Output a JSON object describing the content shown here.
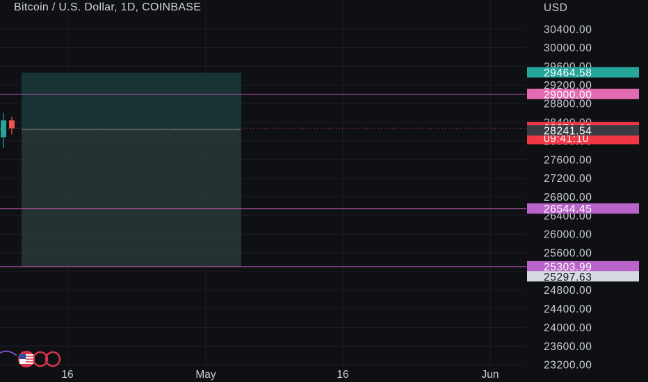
{
  "header": {
    "title": "Bitcoin / U.S. Dollar, 1D, COINBASE",
    "currency": "USD"
  },
  "colors": {
    "background": "#0f1014",
    "grid": "#1c1e24",
    "profit_zone": "#1a3a38",
    "loss_zone": "#2b3a3a",
    "horizontal_line": "#c25ab7",
    "up_candle": "#26a69a",
    "down_candle": "#ef5350",
    "tag_green": "#26a69a",
    "tag_pink": "#e26bb2",
    "tag_red": "#f23645",
    "tag_purple": "#b964c9",
    "tag_dark": "#3a3c43",
    "tag_light": "#d6dbe1"
  },
  "chart_data": {
    "type": "candlestick",
    "title": "Bitcoin / U.S. Dollar, 1D, COINBASE",
    "ylabel": "USD",
    "ylim": [
      23050,
      30720
    ],
    "yticks": [
      23200,
      23600,
      24000,
      24400,
      24800,
      25200,
      25600,
      26000,
      26400,
      26800,
      27200,
      27600,
      28000,
      28400,
      28800,
      29200,
      29600,
      30000,
      30400
    ],
    "xticks": [
      "16",
      "May",
      "16",
      "Jun"
    ],
    "grid": true,
    "candles": [
      {
        "open": 28080,
        "high": 28600,
        "low": 27850,
        "close": 28440
      },
      {
        "open": 28440,
        "high": 28520,
        "low": 28140,
        "close": 28271
      }
    ],
    "position": {
      "target": 29464.58,
      "entry": 28241.54,
      "stop": 25297.63
    },
    "horizontal_lines": [
      29000.0,
      26544.45,
      25303.99
    ],
    "price_tags": [
      {
        "label": "29464.58",
        "value": 29464.58,
        "role": "target",
        "color": "tag_green"
      },
      {
        "label": "29000.00",
        "value": 29000.0,
        "role": "line",
        "color": "tag_pink"
      },
      {
        "label": "28271.08",
        "countdown": "09:41:10",
        "value": 28271.08,
        "role": "last-price",
        "color": "tag_red"
      },
      {
        "label": "28241.54",
        "value": 28241.54,
        "role": "entry",
        "color": "tag_dark"
      },
      {
        "label": "26544.45",
        "value": 26544.45,
        "role": "line",
        "color": "tag_purple"
      },
      {
        "label": "25303.99",
        "value": 25303.99,
        "role": "line",
        "color": "tag_purple"
      },
      {
        "label": "25297.63",
        "value": 25297.63,
        "role": "stop",
        "color": "tag_light"
      }
    ]
  }
}
